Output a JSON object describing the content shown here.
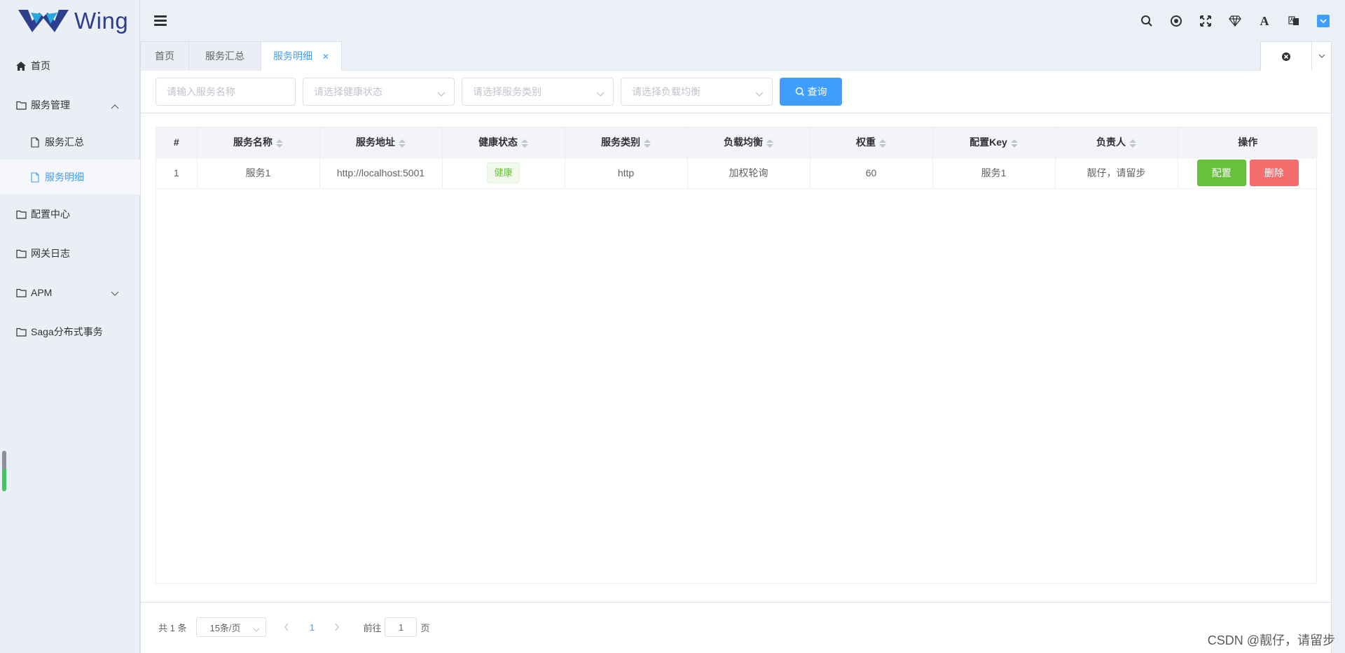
{
  "app": {
    "name": "Wing",
    "brand_color": "#2c3e8c",
    "accent": "#409eff"
  },
  "sidebar": {
    "items": [
      {
        "label": "首页",
        "icon": "home-icon"
      },
      {
        "label": "服务管理",
        "icon": "folder-icon",
        "expanded": true,
        "children": [
          {
            "label": "服务汇总",
            "icon": "file-icon"
          },
          {
            "label": "服务明细",
            "icon": "file-icon",
            "active": true
          }
        ]
      },
      {
        "label": "配置中心",
        "icon": "folder-icon"
      },
      {
        "label": "网关日志",
        "icon": "folder-icon"
      },
      {
        "label": "APM",
        "icon": "folder-icon",
        "expanded": false
      },
      {
        "label": "Saga分布式事务",
        "icon": "folder-icon"
      }
    ]
  },
  "header": {
    "icons": [
      "search-icon",
      "target-icon",
      "fullscreen-icon",
      "diamond-icon",
      "font-size-icon",
      "translate-icon",
      "dropdown-icon"
    ]
  },
  "tabs": [
    {
      "label": "首页"
    },
    {
      "label": "服务汇总"
    },
    {
      "label": "服务明细",
      "active": true,
      "closable": true
    }
  ],
  "filters": {
    "name_placeholder": "请输入服务名称",
    "health_placeholder": "请选择健康状态",
    "category_placeholder": "请选择服务类别",
    "lb_placeholder": "请选择负载均衡",
    "query_label": "查询"
  },
  "table": {
    "columns": [
      "#",
      "服务名称",
      "服务地址",
      "健康状态",
      "服务类别",
      "负载均衡",
      "权重",
      "配置Key",
      "负责人",
      "操作"
    ],
    "rows": [
      {
        "index": "1",
        "name": "服务1",
        "address": "http://localhost:5001",
        "health": "健康",
        "category": "http",
        "lb": "加权轮询",
        "weight": "60",
        "config_key": "服务1",
        "owner": "靓仔，请留步",
        "config_label": "配置",
        "delete_label": "删除"
      }
    ]
  },
  "pager": {
    "total": "共 1 条",
    "page_size": "15条/页",
    "current": "1",
    "goto_prefix": "前往",
    "goto_value": "1",
    "goto_suffix": "页"
  },
  "watermark": "CSDN @靓仔，请留步"
}
